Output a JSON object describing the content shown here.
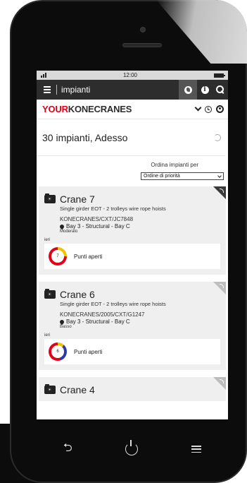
{
  "status_bar": {
    "time": "12:00"
  },
  "app_bar": {
    "title": "impianti"
  },
  "brand": {
    "part1": "YOUR",
    "part2": "KONECRANES"
  },
  "summary": {
    "text": "30 impianti, Adesso"
  },
  "sort": {
    "label": "Ordina impianti per",
    "selected": "Ordine di priorità"
  },
  "cards": [
    {
      "title": "Crane 7",
      "description": "Single girder EOT - 2 trolleys wire rope hoists",
      "code": "KONECRANES/CXT/JC7848",
      "location": "Bay 3 - Structural - Bay C",
      "priority": "Moderato",
      "when": "ieri",
      "open_count": "7",
      "open_label": "Punti aperti"
    },
    {
      "title": "Crane 6",
      "description": "Single girder EOT - 2 trolleys wire rope hoists",
      "code": "KONECRANES/2005/CXT/G1247",
      "location": "Bay 3 - Structural - Bay C",
      "priority": "Basso",
      "when": "ieri",
      "open_count": "6",
      "open_label": "Punti aperti"
    },
    {
      "title": "Crane 4"
    }
  ],
  "colors": {
    "brand_red": "#e2001a",
    "app_bar": "#2d2d2d",
    "ring_yellow": "#f2c200",
    "ring_blue": "#2a3aa8"
  },
  "icons": [
    "menu-icon",
    "globe-icon",
    "info-icon",
    "search-icon",
    "chevron-down-icon",
    "clock-icon",
    "user-icon",
    "refresh-icon",
    "crane-icon",
    "rss-icon",
    "location-pin-icon",
    "back-icon",
    "power-icon",
    "nav-menu-icon"
  ]
}
